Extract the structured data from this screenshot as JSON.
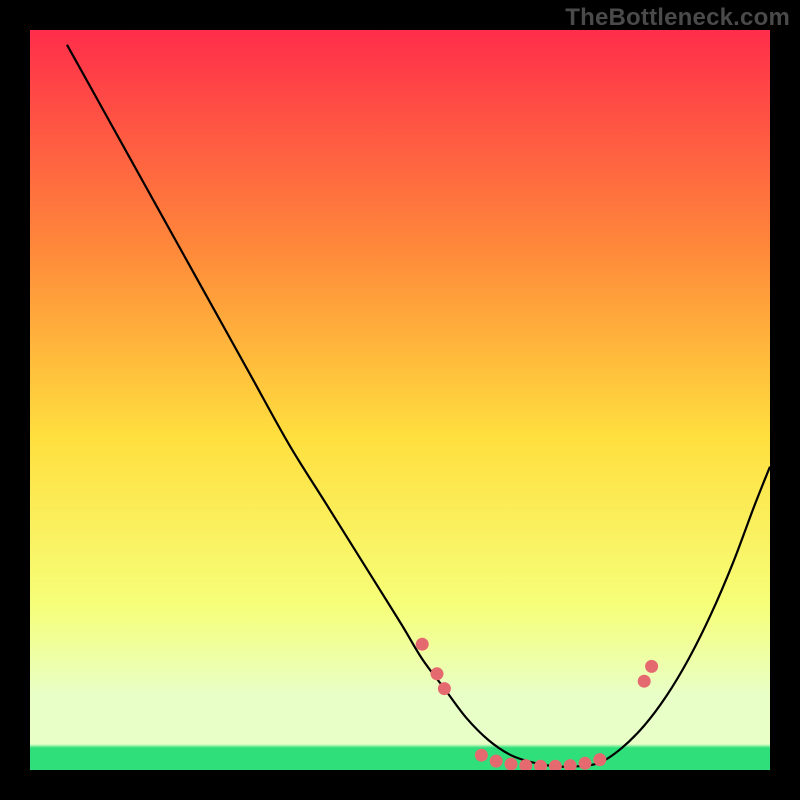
{
  "watermark": "TheBottleneck.com",
  "colors": {
    "black": "#000000",
    "curve": "#000000",
    "dots": "#e56a6f",
    "grad_top": "#ff2d4a",
    "grad_mid_upper": "#ff8a3a",
    "grad_mid": "#ffdf3e",
    "grad_lower": "#f6ff7a",
    "grad_pale": "#e8ffc8",
    "grad_green": "#2fe07a"
  },
  "chart_data": {
    "type": "line",
    "title": "",
    "xlabel": "",
    "ylabel": "",
    "xlim": [
      0,
      100
    ],
    "ylim": [
      0,
      100
    ],
    "series": [
      {
        "name": "bottleneck-curve",
        "x": [
          5,
          10,
          15,
          20,
          25,
          30,
          35,
          40,
          45,
          50,
          53,
          56,
          59,
          62,
          65,
          68,
          71,
          74,
          77,
          80,
          83,
          86,
          89,
          92,
          95,
          98,
          100
        ],
        "y": [
          98,
          89,
          80,
          71,
          62,
          53,
          44,
          36,
          28,
          20,
          15,
          11,
          7,
          4,
          2,
          1,
          0.5,
          0.5,
          1,
          3,
          6,
          10,
          15,
          21,
          28,
          36,
          41
        ]
      }
    ],
    "markers": [
      {
        "x": 53,
        "y": 17
      },
      {
        "x": 55,
        "y": 13
      },
      {
        "x": 56,
        "y": 11
      },
      {
        "x": 61,
        "y": 2
      },
      {
        "x": 63,
        "y": 1.2
      },
      {
        "x": 65,
        "y": 0.8
      },
      {
        "x": 67,
        "y": 0.6
      },
      {
        "x": 69,
        "y": 0.5
      },
      {
        "x": 71,
        "y": 0.5
      },
      {
        "x": 73,
        "y": 0.6
      },
      {
        "x": 75,
        "y": 0.9
      },
      {
        "x": 77,
        "y": 1.4
      },
      {
        "x": 83,
        "y": 12
      },
      {
        "x": 84,
        "y": 14
      }
    ],
    "gradient_stops": [
      {
        "offset": 0.0,
        "color_key": "grad_top"
      },
      {
        "offset": 0.3,
        "color_key": "grad_mid_upper"
      },
      {
        "offset": 0.55,
        "color_key": "grad_mid"
      },
      {
        "offset": 0.78,
        "color_key": "grad_lower"
      },
      {
        "offset": 0.9,
        "color_key": "grad_pale"
      },
      {
        "offset": 0.965,
        "color_key": "grad_pale"
      },
      {
        "offset": 0.97,
        "color_key": "grad_green"
      },
      {
        "offset": 1.0,
        "color_key": "grad_green"
      }
    ]
  }
}
